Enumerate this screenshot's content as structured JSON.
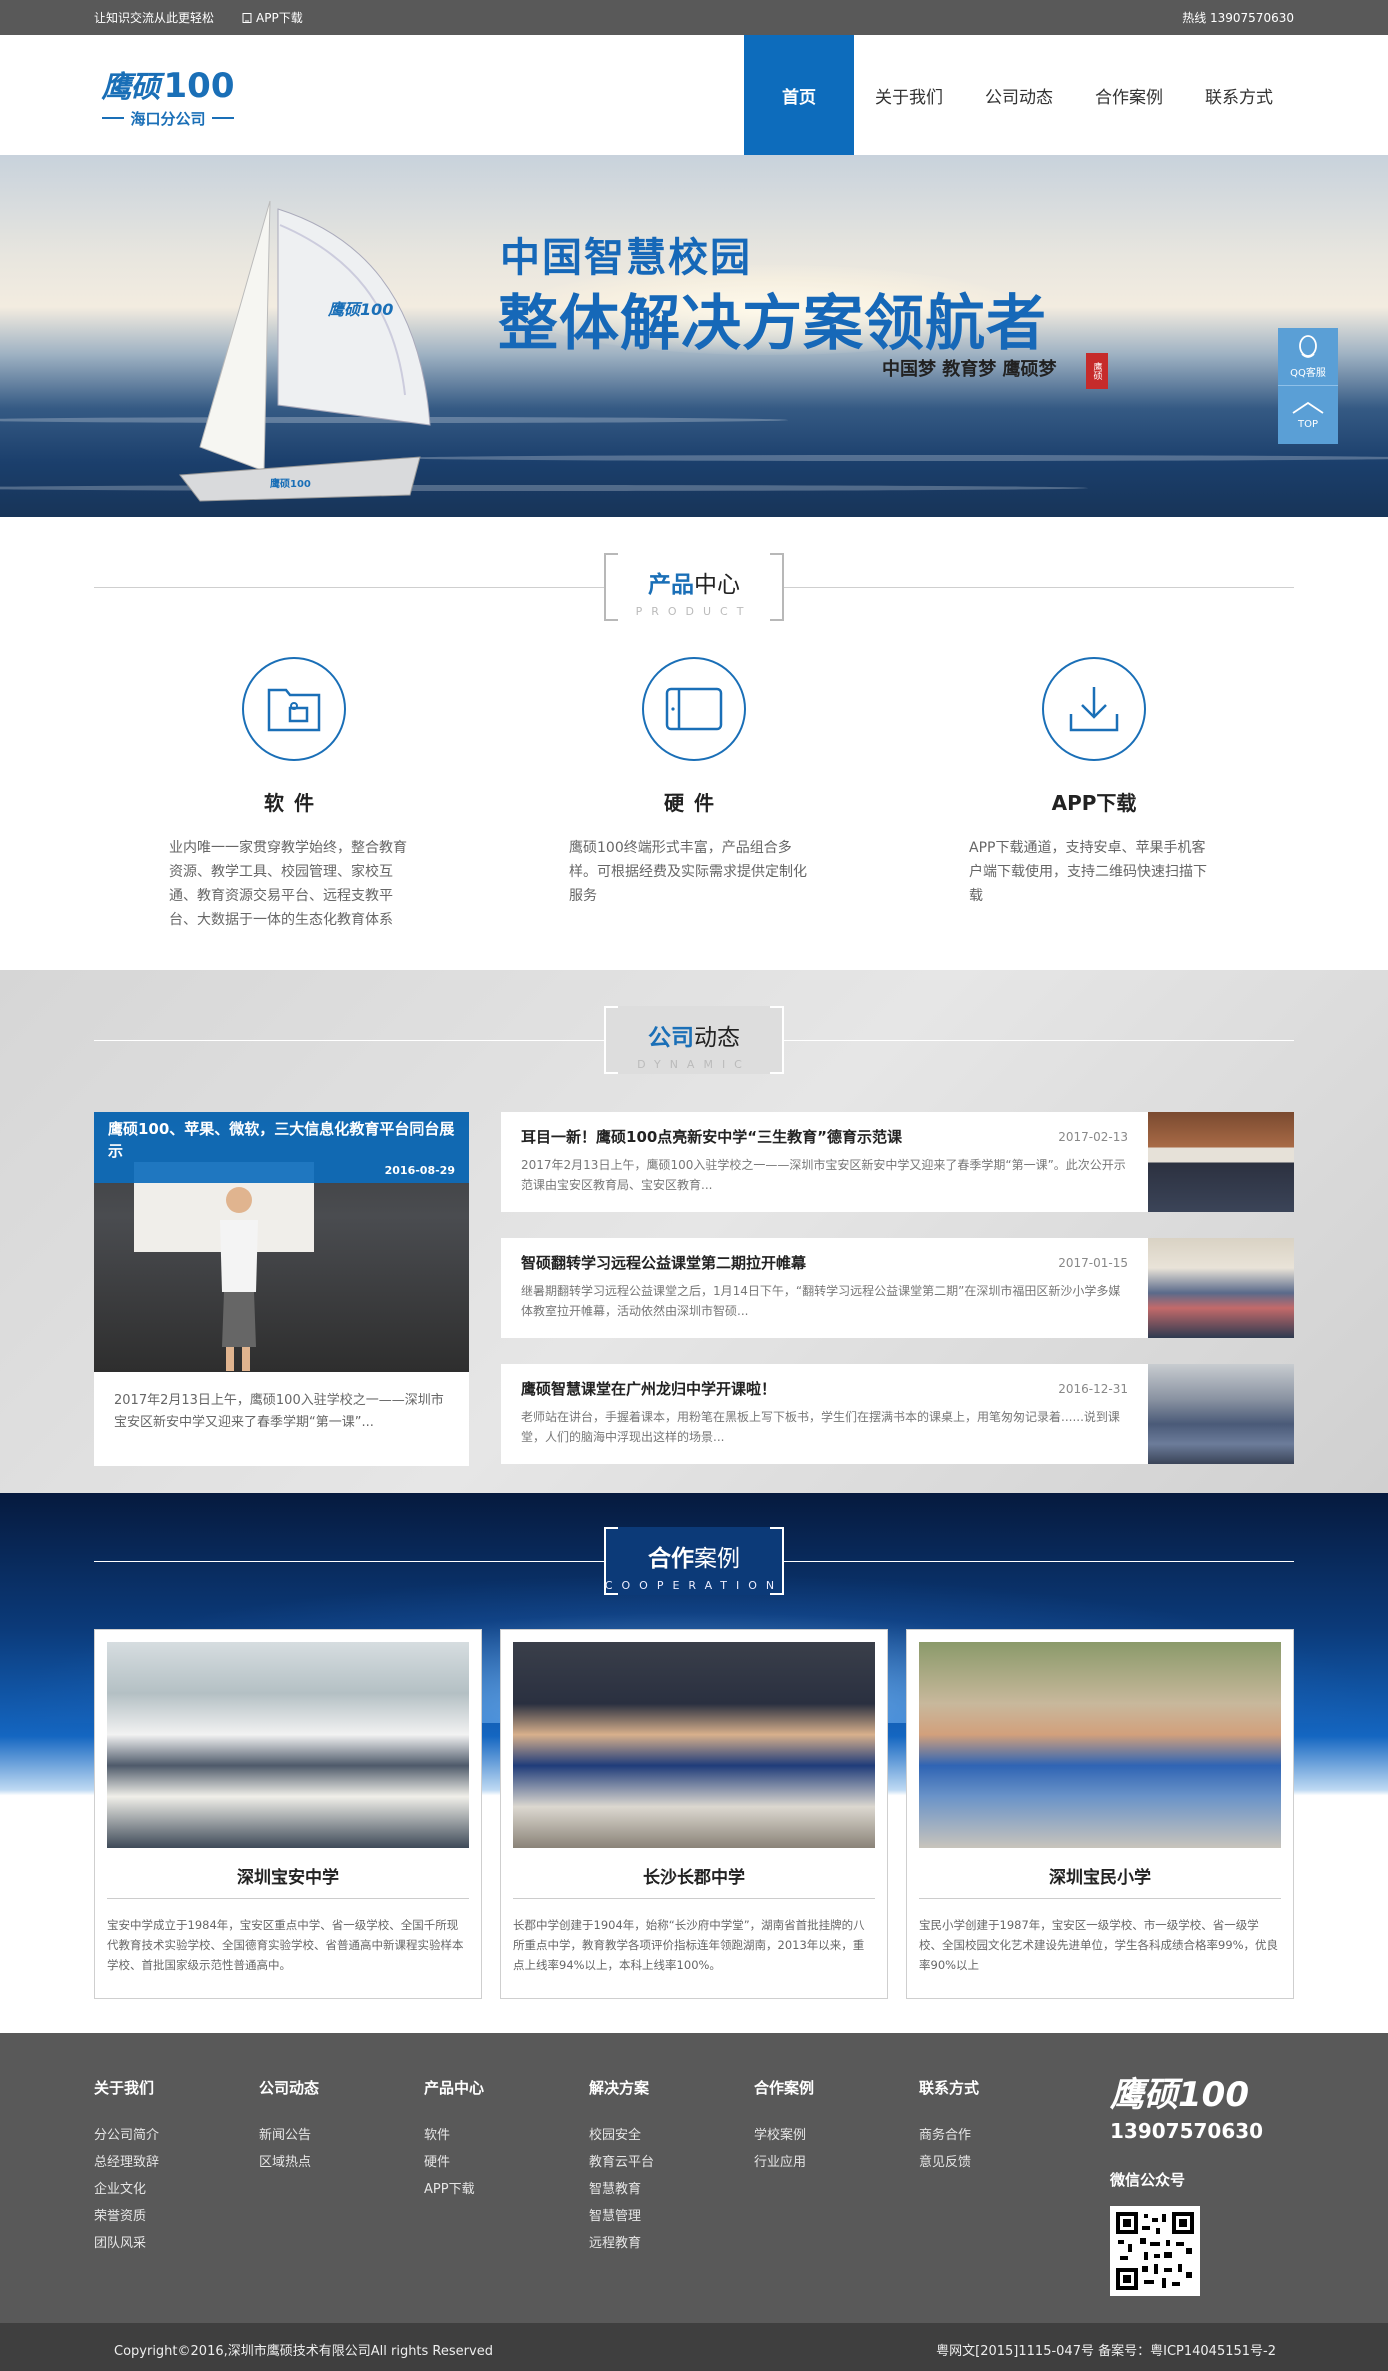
{
  "topbar": {
    "slogan": "让知识交流从此更轻松",
    "app_download": "APP下载",
    "hotline": "热线 13907570630"
  },
  "header": {
    "logo_cn": "鹰硕",
    "logo_num": "100",
    "logo_sub": "海口分公司",
    "nav": [
      "首页",
      "关于我们",
      "公司动态",
      "合作案例",
      "联系方式"
    ]
  },
  "banner": {
    "title1": "中国智慧校园",
    "title2": "整体解决方案领航者",
    "slogan": "中国梦 教育梦 鹰硕梦",
    "seal": "鹰硕"
  },
  "float": {
    "qq": "QQ客服",
    "top": "TOP"
  },
  "product": {
    "title_hl": "产品",
    "title_rest": "中心",
    "title_en": "PRODUCT",
    "items": [
      {
        "title": "软件",
        "icon": "folder-icon",
        "desc": "业内唯一一家贯穿教学始终，整合教育资源、教学工具、校园管理、家校互通、教育资源交易平台、远程支教平台、大数据于一体的生态化教育体系"
      },
      {
        "title": "硬件",
        "icon": "tablet-icon",
        "desc": "鹰硕100终端形式丰富，产品组合多样。可根据经费及实际需求提供定制化服务"
      },
      {
        "title": "APP下载",
        "icon": "download-icon",
        "desc": "APP下载通道，支持安卓、苹果手机客户端下载使用，支持二维码快速扫描下载"
      }
    ]
  },
  "news": {
    "title_hl": "公司",
    "title_rest": "动态",
    "title_en": "DYNAMIC",
    "featured": {
      "title": "鹰硕100、苹果、微软，三大信息化教育平台同台展示",
      "date": "2016-08-29",
      "desc": "2017年2月13日上午，鹰硕100入驻学校之一——深圳市宝安区新安中学又迎来了春季学期“第一课”..."
    },
    "items": [
      {
        "title": "耳目一新！鹰硕100点亮新安中学“三生教育”德育示范课",
        "date": "2017-02-13",
        "desc": "2017年2月13日上午，鹰硕100入驻学校之一——深圳市宝安区新安中学又迎来了春季学期“第一课”。此次公开示范课由宝安区教育局、宝安区教育..."
      },
      {
        "title": "智硕翻转学习远程公益课堂第二期拉开帷幕",
        "date": "2017-01-15",
        "desc": "继暑期翻转学习远程公益课堂之后，1月14日下午，“翻转学习远程公益课堂第二期”在深圳市福田区新沙小学多媒体教室拉开帷幕，活动依然由深圳市智硕..."
      },
      {
        "title": "鹰硕智慧课堂在广州龙归中学开课啦！",
        "date": "2016-12-31",
        "desc": "老师站在讲台，手握着课本，用粉笔在黑板上写下板书，学生们在摆满书本的课桌上，用笔匆匆记录着......说到课堂，人们的脑海中浮现出这样的场景..."
      }
    ]
  },
  "cases": {
    "title_hl": "合作",
    "title_rest": "案例",
    "title_en": "COOPERATION",
    "items": [
      {
        "name": "深圳宝安中学",
        "desc": "宝安中学成立于1984年，宝安区重点中学、省一级学校、全国千所现代教育技术实验学校、全国德育实验学校、省普通高中新课程实验样本学校、首批国家级示范性普通高中。"
      },
      {
        "name": "长沙长郡中学",
        "desc": "长郡中学创建于1904年，始称“长沙府中学堂”，湖南省首批挂牌的八所重点中学，教育教学各项评价指标连年领跑湖南，2013年以来，重点上线率94%以上，本科上线率100%。"
      },
      {
        "name": "深圳宝民小学",
        "desc": "宝民小学创建于1987年，宝安区一级学校、市一级学校、省一级学校、全国校园文化艺术建设先进单位，学生各科成绩合格率99%，优良率90%以上"
      }
    ]
  },
  "footer": {
    "columns": [
      {
        "title": "关于我们",
        "links": [
          "分公司简介",
          "总经理致辞",
          "企业文化",
          "荣誉资质",
          "团队风采"
        ]
      },
      {
        "title": "公司动态",
        "links": [
          "新闻公告",
          "区域热点"
        ]
      },
      {
        "title": "产品中心",
        "links": [
          "软件",
          "硬件",
          "APP下载"
        ]
      },
      {
        "title": "解决方案",
        "links": [
          "校园安全",
          "教育云平台",
          "智慧教育",
          "智慧管理",
          "远程教育"
        ]
      },
      {
        "title": "合作案例",
        "links": [
          "学校案例",
          "行业应用"
        ]
      },
      {
        "title": "联系方式",
        "links": [
          "商务合作",
          "意见反馈"
        ]
      }
    ],
    "logo": "鹰硕100",
    "phone": "13907570630",
    "wechat_title": "微信公众号",
    "copyright": "Copyright©2016,深圳市鹰硕技术有限公司All rights Reserved",
    "icp": "粤网文[2015]1115-047号 备案号：粤ICP14045151号-2"
  }
}
